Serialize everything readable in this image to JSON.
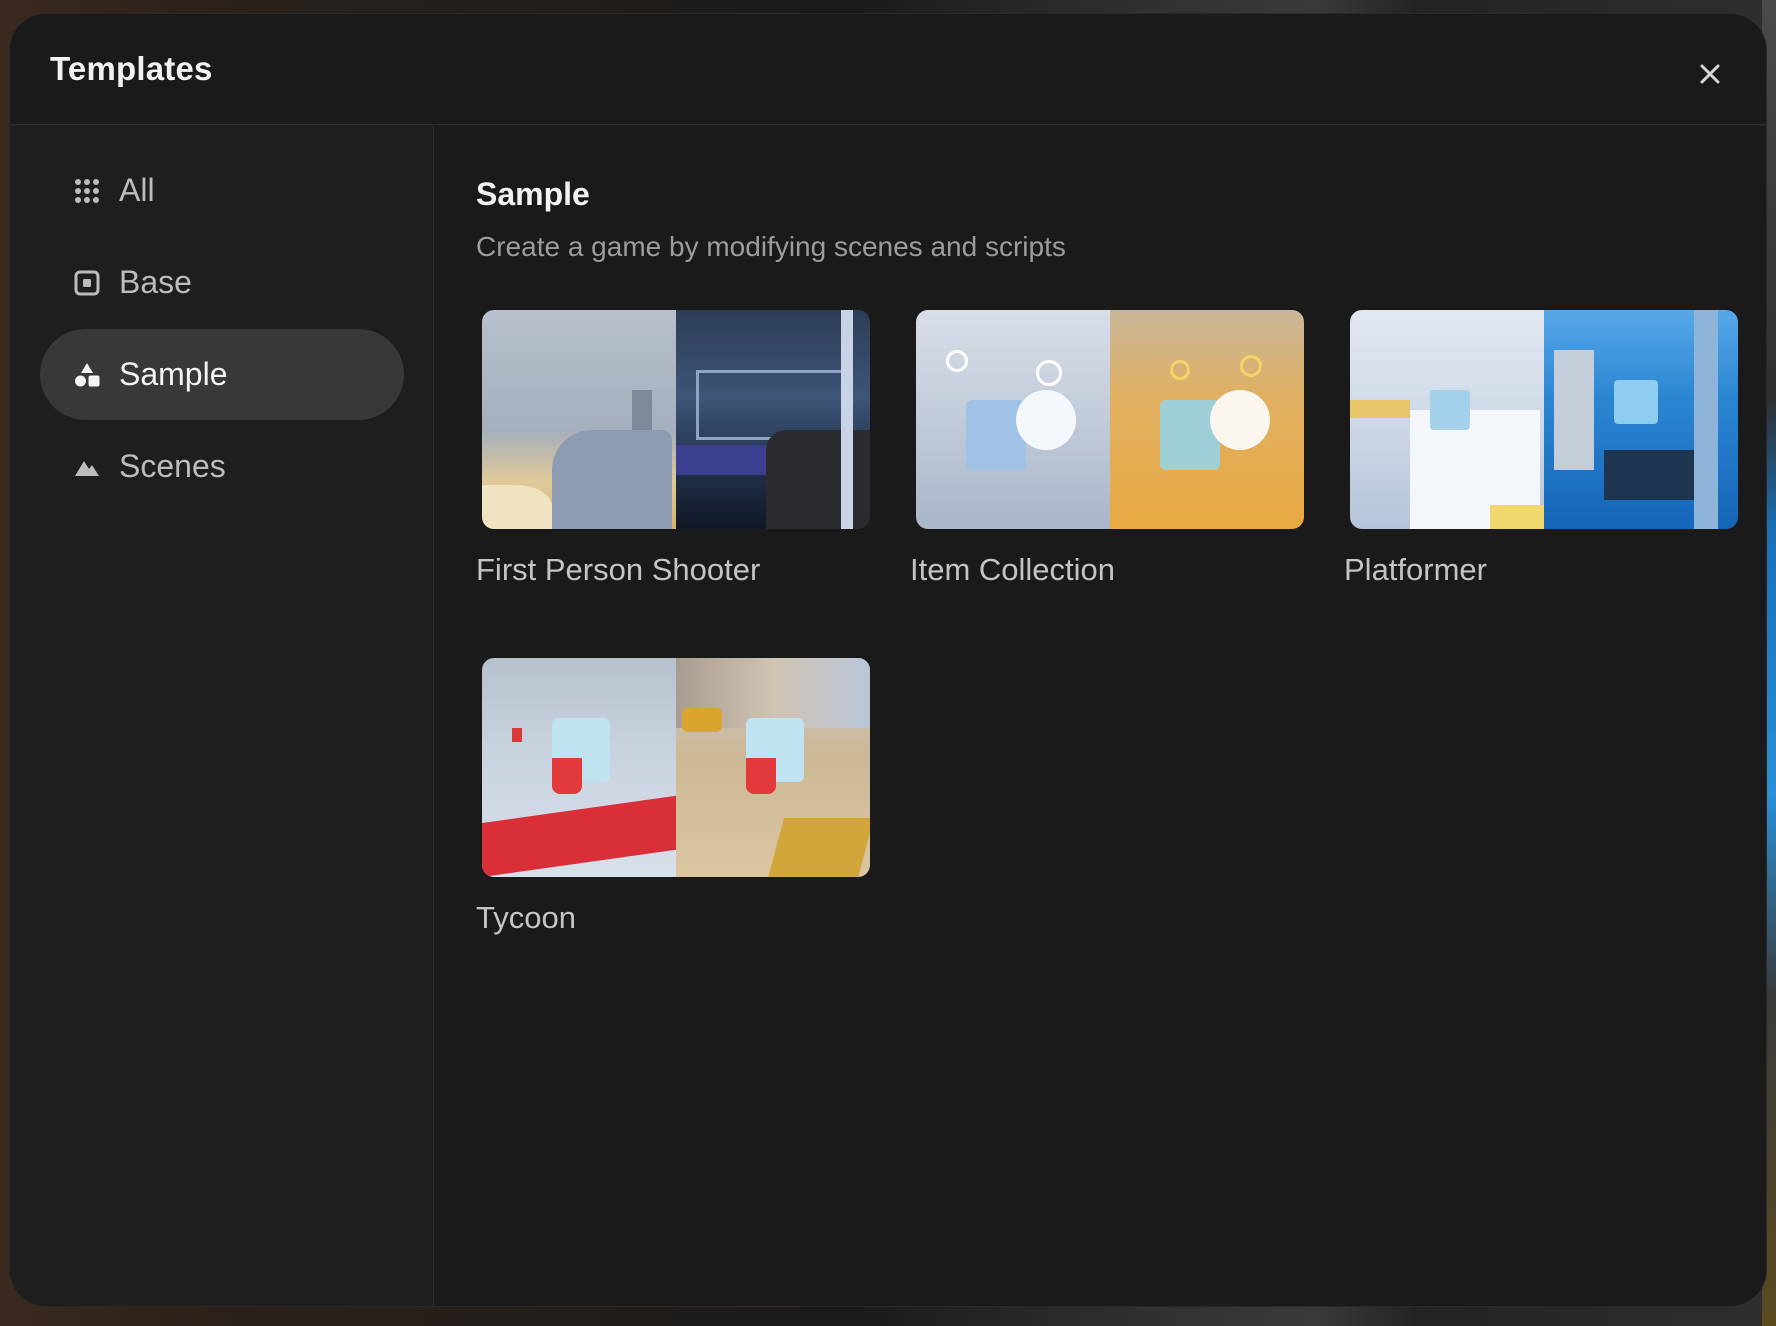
{
  "modal": {
    "title": "Templates"
  },
  "sidebar": {
    "items": [
      {
        "label": "All",
        "icon": "grid-dots-icon",
        "active": false
      },
      {
        "label": "Base",
        "icon": "square-dot-icon",
        "active": false
      },
      {
        "label": "Sample",
        "icon": "shapes-icon",
        "active": true
      },
      {
        "label": "Scenes",
        "icon": "mountain-icon",
        "active": false
      }
    ]
  },
  "main": {
    "section_title": "Sample",
    "section_subtitle": "Create a game by modifying scenes and scripts",
    "templates": [
      {
        "label": "First Person Shooter"
      },
      {
        "label": "Item Collection"
      },
      {
        "label": "Platformer"
      },
      {
        "label": "Tycoon"
      }
    ]
  },
  "colors": {
    "modal_bg": "#1d1d1d",
    "active_item_bg": "#383838",
    "text_primary": "#f2f2f2",
    "text_secondary": "#9c9c9c"
  }
}
